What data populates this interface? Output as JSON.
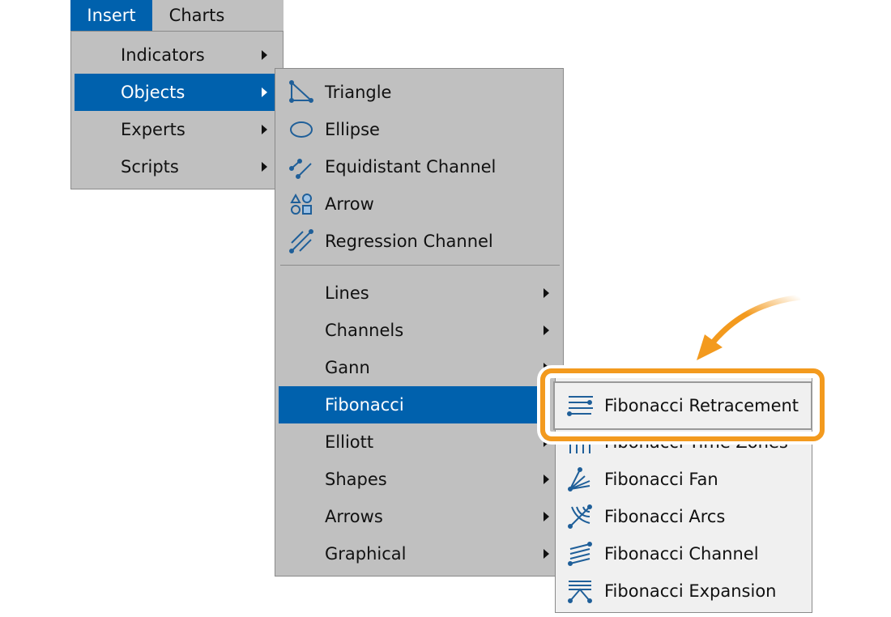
{
  "menubar": {
    "items": [
      {
        "label": "Insert",
        "active": true
      },
      {
        "label": "Charts",
        "active": false
      }
    ]
  },
  "insert_menu": {
    "items": [
      {
        "label": "Indicators",
        "submenu": true
      },
      {
        "label": "Objects",
        "submenu": true,
        "selected": true
      },
      {
        "label": "Experts",
        "submenu": true
      },
      {
        "label": "Scripts",
        "submenu": true
      }
    ]
  },
  "objects_menu": {
    "shapes": [
      {
        "label": "Triangle",
        "icon": "triangle-icon"
      },
      {
        "label": "Ellipse",
        "icon": "ellipse-icon"
      },
      {
        "label": "Equidistant Channel",
        "icon": "equidistant-channel-icon"
      },
      {
        "label": "Arrow",
        "icon": "arrow-shapes-icon"
      },
      {
        "label": "Regression Channel",
        "icon": "regression-channel-icon"
      }
    ],
    "groups": [
      {
        "label": "Lines"
      },
      {
        "label": "Channels"
      },
      {
        "label": "Gann"
      },
      {
        "label": "Fibonacci",
        "selected": true
      },
      {
        "label": "Elliott"
      },
      {
        "label": "Shapes"
      },
      {
        "label": "Arrows"
      },
      {
        "label": "Graphical"
      }
    ]
  },
  "fibonacci_menu": {
    "items": [
      {
        "label": "Fibonacci Retracement",
        "icon": "fibonacci-retracement-icon",
        "highlighted": true
      },
      {
        "label": "Fibonacci Time Zones",
        "icon": "fibonacci-time-zones-icon"
      },
      {
        "label": "Fibonacci Fan",
        "icon": "fibonacci-fan-icon"
      },
      {
        "label": "Fibonacci Arcs",
        "icon": "fibonacci-arcs-icon"
      },
      {
        "label": "Fibonacci Channel",
        "icon": "fibonacci-channel-icon"
      },
      {
        "label": "Fibonacci Expansion",
        "icon": "fibonacci-expansion-icon"
      }
    ]
  },
  "colors": {
    "selection": "#0061ad",
    "menu_bg": "#c0c0c0",
    "submenu_bg": "#f0f0f0",
    "callout": "#f39a1e",
    "icon": "#1f5f99"
  }
}
